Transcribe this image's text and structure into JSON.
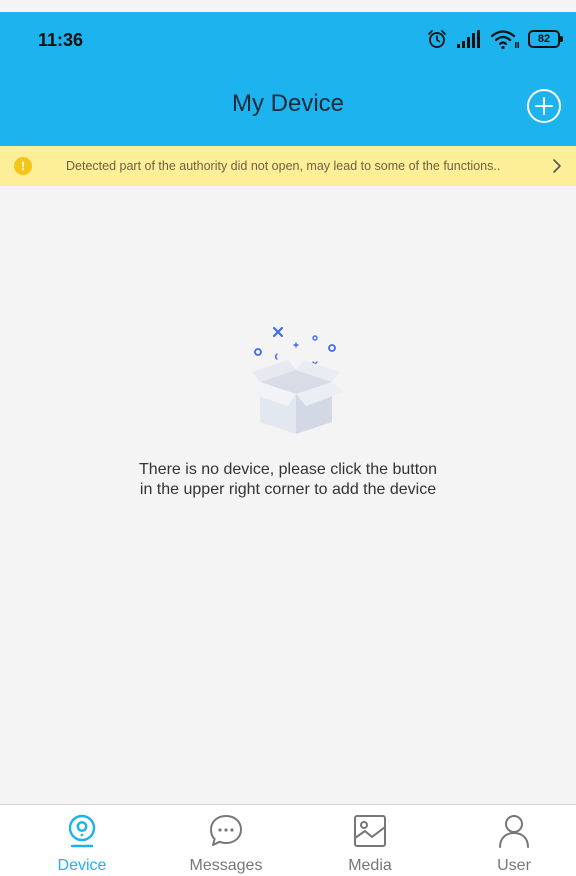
{
  "status_bar": {
    "time": "11:36",
    "battery": "82",
    "icons": [
      "alarm-icon",
      "signal-icon",
      "wifi-icon",
      "battery-icon"
    ]
  },
  "header": {
    "title": "My Device",
    "add_icon": "plus-circle-icon"
  },
  "warning_banner": {
    "text": "Detected part of the authority did not open, may lead to some of the functions..",
    "icon": "exclamation-icon"
  },
  "empty_state": {
    "line1": "There is no device, please click the button",
    "line2": "in the upper right corner to add the device",
    "illustration": "empty-box-illustration"
  },
  "bottom_nav": {
    "active": "Device",
    "items": [
      {
        "label": "Device",
        "icon": "camera-icon"
      },
      {
        "label": "Messages",
        "icon": "chat-bubble-icon"
      },
      {
        "label": "Media",
        "icon": "image-icon"
      },
      {
        "label": "User",
        "icon": "user-icon"
      }
    ]
  },
  "colors": {
    "primary": "#1cb3ee",
    "banner_bg": "#fdee98",
    "banner_icon": "#f5c518",
    "background": "#f4f4f4",
    "inactive": "#777777"
  }
}
